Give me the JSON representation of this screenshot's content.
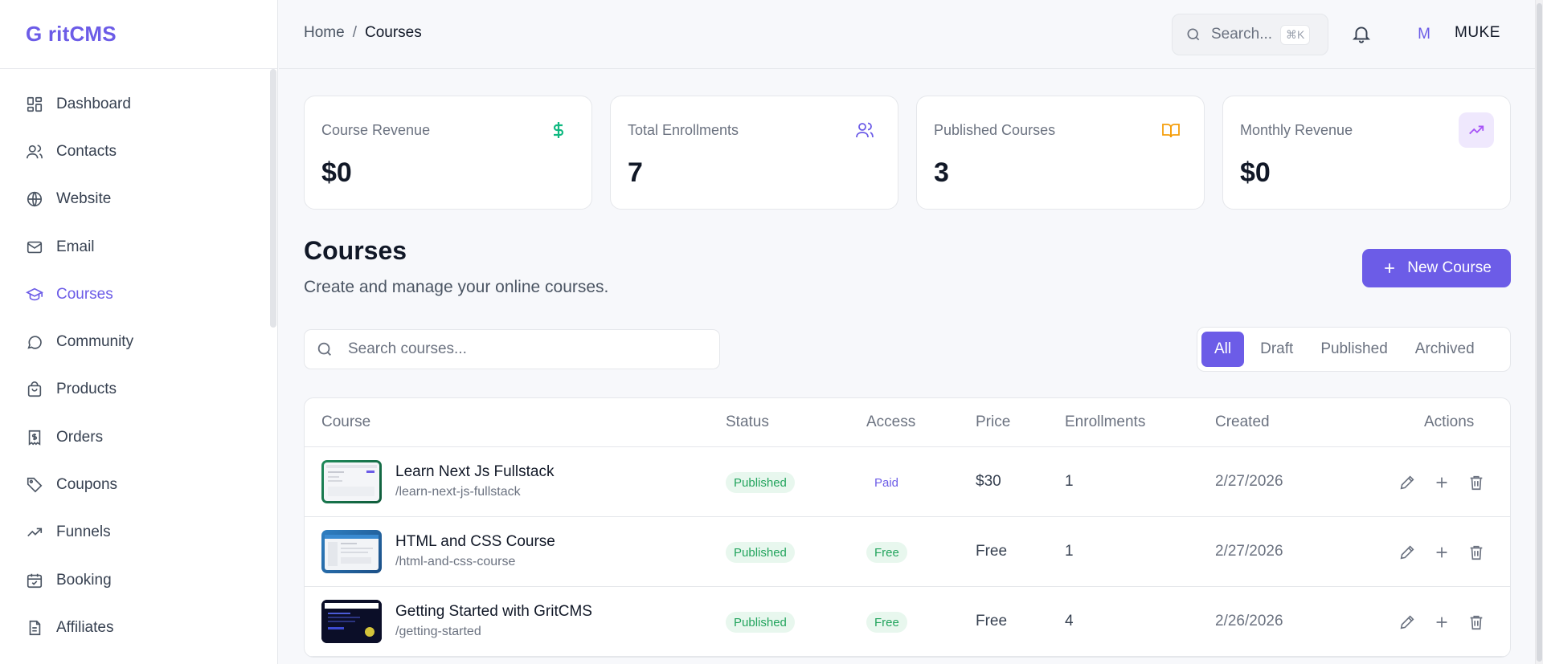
{
  "brand": {
    "name": "G ritCMS"
  },
  "sidebar": {
    "items": [
      {
        "label": "Dashboard",
        "icon": "dashboard-icon"
      },
      {
        "label": "Contacts",
        "icon": "users-icon"
      },
      {
        "label": "Website",
        "icon": "globe-icon"
      },
      {
        "label": "Email",
        "icon": "mail-icon"
      },
      {
        "label": "Courses",
        "icon": "graduation-cap-icon",
        "active": true
      },
      {
        "label": "Community",
        "icon": "chat-bubble-icon"
      },
      {
        "label": "Products",
        "icon": "shopping-bag-icon"
      },
      {
        "label": "Orders",
        "icon": "receipt-icon"
      },
      {
        "label": "Coupons",
        "icon": "tag-icon"
      },
      {
        "label": "Funnels",
        "icon": "trending-up-icon"
      },
      {
        "label": "Booking",
        "icon": "calendar-icon"
      },
      {
        "label": "Affiliates",
        "icon": "document-icon"
      }
    ]
  },
  "header": {
    "breadcrumb": {
      "home": "Home",
      "separator": "/",
      "current": "Courses"
    },
    "search": {
      "placeholder": "Search...",
      "shortcut": "⌘K"
    },
    "user": {
      "initial": "M",
      "name": "MUKE"
    }
  },
  "stats": [
    {
      "label": "Course Revenue",
      "value": "$0",
      "icon": "dollar-icon",
      "color": "#10b981"
    },
    {
      "label": "Total Enrollments",
      "value": "7",
      "icon": "users-icon",
      "color": "#6c5ce7"
    },
    {
      "label": "Published Courses",
      "value": "3",
      "icon": "book-open-icon",
      "color": "#f59e0b"
    },
    {
      "label": "Monthly Revenue",
      "value": "$0",
      "icon": "trending-up-icon",
      "color": "#a855f7"
    }
  ],
  "page": {
    "title": "Courses",
    "subtitle": "Create and manage your online courses.",
    "new_button": "New Course"
  },
  "filters": {
    "search_placeholder": "Search courses...",
    "tabs": [
      "All",
      "Draft",
      "Published",
      "Archived"
    ],
    "active_tab": "All"
  },
  "table": {
    "headers": {
      "course": "Course",
      "status": "Status",
      "access": "Access",
      "price": "Price",
      "enrollments": "Enrollments",
      "created": "Created",
      "actions": "Actions"
    },
    "rows": [
      {
        "name": "Learn Next Js Fullstack",
        "slug": "/learn-next-js-fullstack",
        "status": "Published",
        "access": "Paid",
        "price": "$30",
        "enrollments": "1",
        "created": "2/27/2026"
      },
      {
        "name": "HTML and CSS Course",
        "slug": "/html-and-css-course",
        "status": "Published",
        "access": "Free",
        "price": "Free",
        "enrollments": "1",
        "created": "2/27/2026"
      },
      {
        "name": "Getting Started with GritCMS",
        "slug": "/getting-started",
        "status": "Published",
        "access": "Free",
        "price": "Free",
        "enrollments": "4",
        "created": "2/26/2026"
      }
    ]
  },
  "colors": {
    "accent": "#6c5ce7",
    "success": "#22a45d",
    "success_bg": "#e8f7ee"
  }
}
